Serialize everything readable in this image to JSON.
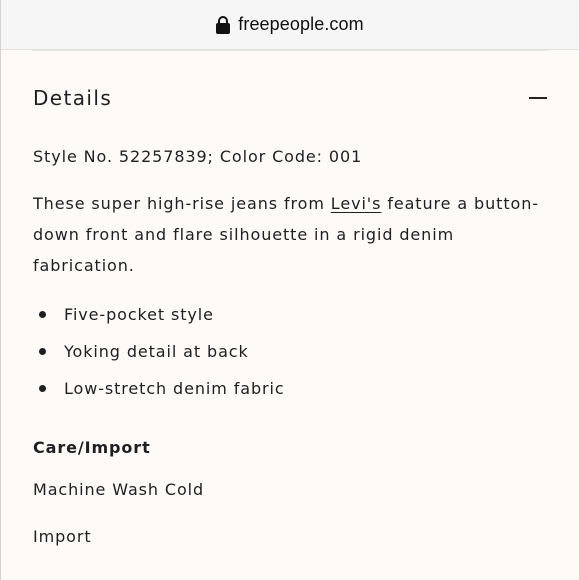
{
  "browser": {
    "domain": "freepeople.com",
    "lock_icon": "lock-icon"
  },
  "details": {
    "title": "Details",
    "collapse_icon": "minus-icon",
    "style_line": "Style No. 52257839; Color Code: 001",
    "description_before": "These super high-rise jeans from ",
    "brand_link": "Levi's",
    "description_after": " feature a button-down front and flare silhouette in a rigid denim fabrication.",
    "bullets": [
      "Five-pocket style",
      "Yoking detail at back",
      "Low-stretch denim fabric"
    ]
  },
  "care": {
    "title": "Care/Import",
    "wash": "Machine Wash Cold",
    "origin": "Import"
  }
}
